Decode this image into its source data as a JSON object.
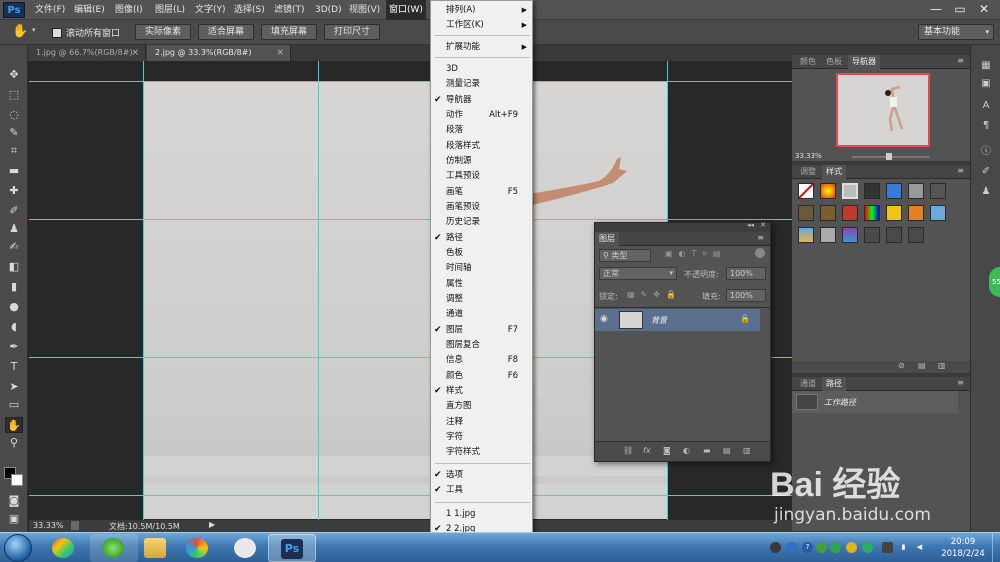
{
  "app": {
    "logo": "Ps"
  },
  "menubar": {
    "items": [
      "文件(F)",
      "编辑(E)",
      "图像(I)",
      "图层(L)",
      "文字(Y)",
      "选择(S)",
      "滤镜(T)",
      "3D(D)",
      "视图(V)",
      "窗口(W)"
    ],
    "active_index": 9
  },
  "window_controls": {
    "minimize": "—",
    "restore": "▭",
    "close": "✕"
  },
  "options_bar": {
    "scroll_all_label": "滚动所有窗口",
    "buttons": [
      "实际像素",
      "适合屏幕",
      "填充屏幕",
      "打印尺寸"
    ],
    "workspace": "基本功能"
  },
  "tabs": [
    {
      "label": "1.jpg @ 66.7%(RGB/8#)",
      "close": "×",
      "active": false
    },
    {
      "label": "2.jpg @ 33.3%(RGB/8#)",
      "close": "×",
      "active": true
    }
  ],
  "status": {
    "zoom": "33.33%",
    "doc": "文档:10.5M/10.5M"
  },
  "window_menu": {
    "items": [
      {
        "label": "排列(A)",
        "arrow": "▶",
        "check": "",
        "shortcut": ""
      },
      {
        "label": "工作区(K)",
        "arrow": "▶",
        "check": "",
        "shortcut": ""
      },
      {
        "label": "扩展功能",
        "arrow": "▶",
        "check": "",
        "shortcut": ""
      },
      {
        "label": "3D",
        "arrow": "",
        "check": "",
        "shortcut": ""
      },
      {
        "label": "测量记录",
        "arrow": "",
        "check": "",
        "shortcut": ""
      },
      {
        "label": "导航器",
        "arrow": "",
        "check": "✔",
        "shortcut": ""
      },
      {
        "label": "动作",
        "arrow": "",
        "check": "",
        "shortcut": "Alt+F9"
      },
      {
        "label": "段落",
        "arrow": "",
        "check": "",
        "shortcut": ""
      },
      {
        "label": "段落样式",
        "arrow": "",
        "check": "",
        "shortcut": ""
      },
      {
        "label": "仿制源",
        "arrow": "",
        "check": "",
        "shortcut": ""
      },
      {
        "label": "工具预设",
        "arrow": "",
        "check": "",
        "shortcut": ""
      },
      {
        "label": "画笔",
        "arrow": "",
        "check": "",
        "shortcut": "F5"
      },
      {
        "label": "画笔预设",
        "arrow": "",
        "check": "",
        "shortcut": ""
      },
      {
        "label": "历史记录",
        "arrow": "",
        "check": "",
        "shortcut": ""
      },
      {
        "label": "路径",
        "arrow": "",
        "check": "✔",
        "shortcut": ""
      },
      {
        "label": "色板",
        "arrow": "",
        "check": "",
        "shortcut": ""
      },
      {
        "label": "时间轴",
        "arrow": "",
        "check": "",
        "shortcut": ""
      },
      {
        "label": "属性",
        "arrow": "",
        "check": "",
        "shortcut": ""
      },
      {
        "label": "调整",
        "arrow": "",
        "check": "",
        "shortcut": ""
      },
      {
        "label": "通道",
        "arrow": "",
        "check": "",
        "shortcut": ""
      },
      {
        "label": "图层",
        "arrow": "",
        "check": "✔",
        "shortcut": "F7"
      },
      {
        "label": "图层复合",
        "arrow": "",
        "check": "",
        "shortcut": ""
      },
      {
        "label": "信息",
        "arrow": "",
        "check": "",
        "shortcut": "F8"
      },
      {
        "label": "颜色",
        "arrow": "",
        "check": "",
        "shortcut": "F6"
      },
      {
        "label": "样式",
        "arrow": "",
        "check": "✔",
        "shortcut": ""
      },
      {
        "label": "直方图",
        "arrow": "",
        "check": "",
        "shortcut": ""
      },
      {
        "label": "注释",
        "arrow": "",
        "check": "",
        "shortcut": ""
      },
      {
        "label": "字符",
        "arrow": "",
        "check": "",
        "shortcut": ""
      },
      {
        "label": "字符样式",
        "arrow": "",
        "check": "",
        "shortcut": ""
      },
      {
        "label": "选项",
        "arrow": "",
        "check": "✔",
        "shortcut": ""
      },
      {
        "label": "工具",
        "arrow": "",
        "check": "✔",
        "shortcut": ""
      },
      {
        "label": "1 1.jpg",
        "arrow": "",
        "check": "",
        "shortcut": ""
      },
      {
        "label": "2 2.jpg",
        "arrow": "",
        "check": "✔",
        "shortcut": ""
      }
    ]
  },
  "panels": {
    "top_tabs": [
      "颜色",
      "色板",
      "导航器"
    ],
    "navigator_zoom": "33.33%",
    "mid_tabs": [
      "调整",
      "样式"
    ],
    "bottom_tabs": [
      "通道",
      "路径"
    ],
    "path_item": "工作路径"
  },
  "layers_panel": {
    "title": "图层",
    "filter": "类型",
    "blend_mode": "正常",
    "opacity_label": "不透明度:",
    "opacity_value": "100%",
    "lock_label": "锁定:",
    "fill_label": "填充:",
    "fill_value": "100%",
    "layer_name": "背景"
  },
  "taskbar": {
    "time": "20:09",
    "date": "2018/2/24"
  },
  "watermark": {
    "brand": "Bai  经验",
    "url": "jingyan.baidu.com"
  },
  "colors": {
    "accent_guides": "#35d5e6",
    "menu_bg": "#f0f0f0",
    "taskbar": "#3f78b3"
  }
}
